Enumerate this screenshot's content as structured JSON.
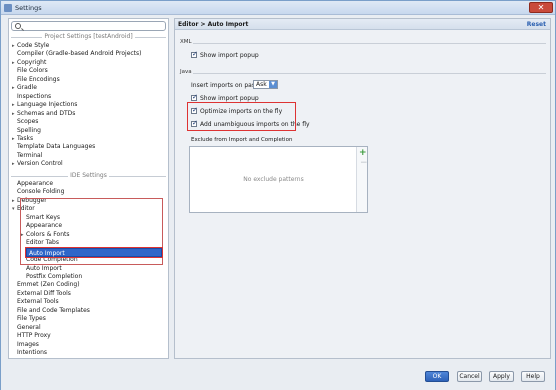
{
  "window": {
    "title": "Settings",
    "close_glyph": "✕"
  },
  "search": {
    "placeholder": ""
  },
  "left": {
    "project_group": "Project Settings [testAndroid]",
    "project_items": [
      {
        "label": "Code Style",
        "arrow": "▸"
      },
      {
        "label": "Compiler (Gradle-based Android Projects)",
        "arrow": ""
      },
      {
        "label": "Copyright",
        "arrow": "▸"
      },
      {
        "label": "File Colors",
        "arrow": ""
      },
      {
        "label": "File Encodings",
        "arrow": ""
      },
      {
        "label": "Gradle",
        "arrow": "▸"
      },
      {
        "label": "Inspections",
        "arrow": ""
      },
      {
        "label": "Language Injections",
        "arrow": "▸"
      },
      {
        "label": "Schemas and DTDs",
        "arrow": "▸"
      },
      {
        "label": "Scopes",
        "arrow": ""
      },
      {
        "label": "Spelling",
        "arrow": ""
      },
      {
        "label": "Tasks",
        "arrow": "▸"
      },
      {
        "label": "Template Data Languages",
        "arrow": ""
      },
      {
        "label": "Terminal",
        "arrow": ""
      },
      {
        "label": "Version Control",
        "arrow": "▸"
      }
    ],
    "ide_group": "IDE Settings",
    "ide_items": [
      {
        "label": "Appearance",
        "arrow": ""
      },
      {
        "label": "Console Folding",
        "arrow": ""
      },
      {
        "label": "Debugger",
        "arrow": "▸"
      },
      {
        "label": "Editor",
        "arrow": "▾"
      },
      {
        "label": "Smart Keys",
        "arrow": ""
      },
      {
        "label": "Appearance",
        "arrow": ""
      },
      {
        "label": "Colors & Fonts",
        "arrow": "▸"
      },
      {
        "label": "Editor Tabs",
        "arrow": ""
      },
      {
        "label": "Code Folding",
        "arrow": ""
      },
      {
        "label": "Code Completion",
        "arrow": ""
      },
      {
        "label": "Auto Import",
        "arrow": ""
      },
      {
        "label": "Postfix Completion",
        "arrow": ""
      },
      {
        "label": "Emmet (Zen Coding)",
        "arrow": ""
      },
      {
        "label": "External Diff Tools",
        "arrow": ""
      },
      {
        "label": "External Tools",
        "arrow": ""
      },
      {
        "label": "File and Code Templates",
        "arrow": ""
      },
      {
        "label": "File Types",
        "arrow": ""
      },
      {
        "label": "General",
        "arrow": ""
      },
      {
        "label": "HTTP Proxy",
        "arrow": ""
      },
      {
        "label": "Images",
        "arrow": ""
      },
      {
        "label": "Intentions",
        "arrow": ""
      }
    ]
  },
  "right": {
    "breadcrumb": "Editor > Auto Import",
    "reset": "Reset",
    "xml_label": "XML",
    "xml_show_popup": "Show import popup",
    "java_label": "Java",
    "paste_label": "Insert imports on paste:",
    "paste_value": "Ask",
    "java_show_popup": "Show import popup",
    "optimize": "Optimize imports on the fly",
    "unambiguous": "Add unambiguous imports on the fly",
    "exclude_label": "Exclude from Import and Completion",
    "exclude_empty": "No exclude patterns",
    "plus": "+",
    "minus": "−"
  },
  "buttons": {
    "ok": "OK",
    "cancel": "Cancel",
    "apply": "Apply",
    "help": "Help"
  }
}
